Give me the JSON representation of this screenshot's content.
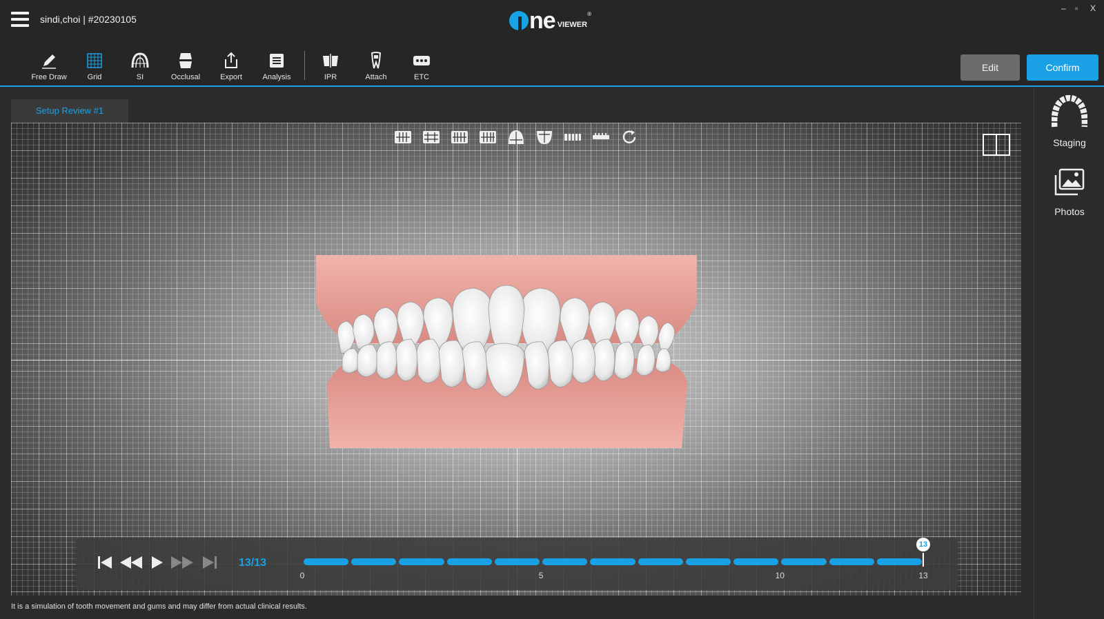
{
  "header": {
    "patient": "sindi,choi | #20230105",
    "logo_main": "ne",
    "logo_sub": "VIEWER",
    "logo_reg": "®",
    "minimize": "–",
    "restore": "▫",
    "close": "X"
  },
  "toolbar": {
    "tools": [
      {
        "label": "Free Draw",
        "icon": "pencil-icon"
      },
      {
        "label": "Grid",
        "icon": "grid-icon"
      },
      {
        "label": "SI",
        "icon": "arch-icon"
      },
      {
        "label": "Occlusal",
        "icon": "tooth-stack-icon"
      },
      {
        "label": "Export",
        "icon": "export-icon"
      },
      {
        "label": "Analysis",
        "icon": "analysis-icon"
      },
      {
        "label": "IPR",
        "icon": "ipr-icon"
      },
      {
        "label": "Attach",
        "icon": "attach-tooth-icon"
      },
      {
        "label": "ETC",
        "icon": "more-icon"
      }
    ],
    "edit_label": "Edit",
    "confirm_label": "Confirm"
  },
  "sidepanel": {
    "staging_label": "Staging",
    "photos_label": "Photos"
  },
  "tab": {
    "label": "Setup Review #1"
  },
  "player": {
    "counter": "13/13",
    "current_stage": 13,
    "total_stages": 13,
    "tick_labels": [
      "0",
      "5",
      "10",
      "13"
    ],
    "thumb_label": "13"
  },
  "colors": {
    "accent": "#1aa0e4",
    "edit_button": "#6b6b6b",
    "gum": "#e9a49c"
  },
  "disclaimer": "It is a simulation of tooth movement and gums and may differ from actual clinical results."
}
